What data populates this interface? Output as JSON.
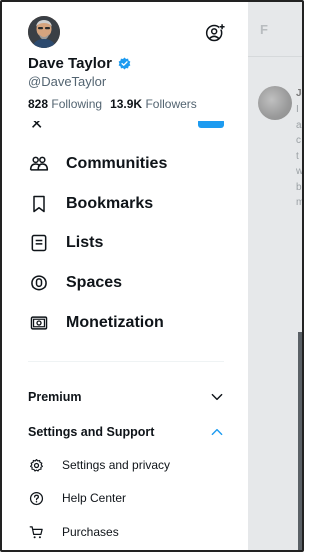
{
  "profile": {
    "display_name": "Dave Taylor",
    "handle": "@DaveTaylor",
    "following_count": "828",
    "following_label": "Following",
    "followers_count": "13.9K",
    "followers_label": "Followers"
  },
  "menu": {
    "items": [
      {
        "label": "Communities",
        "icon": "communities-icon"
      },
      {
        "label": "Bookmarks",
        "icon": "bookmark-icon"
      },
      {
        "label": "Lists",
        "icon": "lists-icon"
      },
      {
        "label": "Spaces",
        "icon": "spaces-icon"
      },
      {
        "label": "Monetization",
        "icon": "monetization-icon"
      }
    ]
  },
  "sections": {
    "premium_label": "Premium",
    "settings_support_label": "Settings and Support",
    "sub_items": [
      {
        "label": "Settings and privacy",
        "icon": "gear-icon"
      },
      {
        "label": "Help Center",
        "icon": "help-circle-icon"
      },
      {
        "label": "Purchases",
        "icon": "cart-icon"
      }
    ]
  },
  "background": {
    "tab_letter": "F",
    "post_author_abbrev": "Je",
    "post_text_fragments": [
      "I",
      "a",
      "c",
      "t",
      "w",
      "b",
      "m"
    ]
  },
  "colors": {
    "accent": "#1d9bf0",
    "text_primary": "#0f1419",
    "text_secondary": "#536471",
    "backdrop": "#e6e8ea"
  }
}
